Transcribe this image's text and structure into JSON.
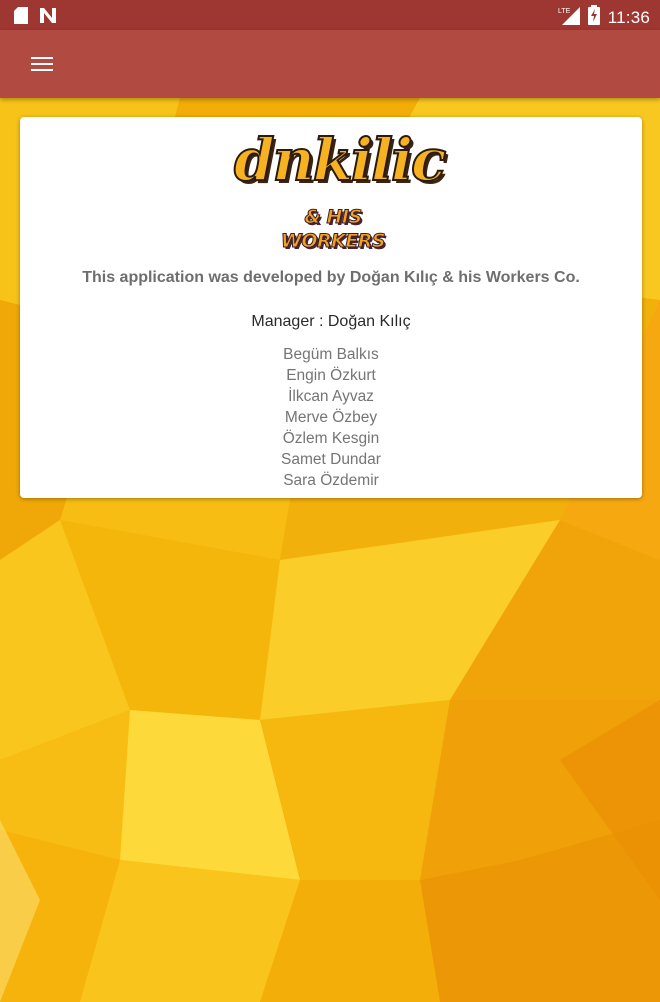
{
  "status_bar": {
    "time": "11:36",
    "left_icons": [
      "sd-card-icon",
      "n-notification-icon"
    ],
    "right_icons": [
      "lte-signal-icon",
      "battery-charging-icon"
    ],
    "network_label": "LTE"
  },
  "app_bar": {
    "menu_icon": "hamburger-menu-icon",
    "background_color": "#b14a40",
    "status_color": "#9e3631"
  },
  "card": {
    "logo": {
      "main": "dnkilic",
      "sub": "& HIS WORKERS"
    },
    "developer_text": "This application was developed by Doğan Kılıç & his Workers Co.",
    "manager_text": "Manager : Doğan Kılıç",
    "workers": [
      "Begüm Balkıs",
      "Engin Özkurt",
      "İlkcan Ayvaz",
      "Merve Özbey",
      "Özlem Kesgin",
      "Samet Dundar",
      "Sara Özdemir"
    ]
  },
  "background": {
    "palette": [
      "#f5b800",
      "#f7c514",
      "#f0a30a",
      "#fbd33a",
      "#eb9600"
    ]
  }
}
